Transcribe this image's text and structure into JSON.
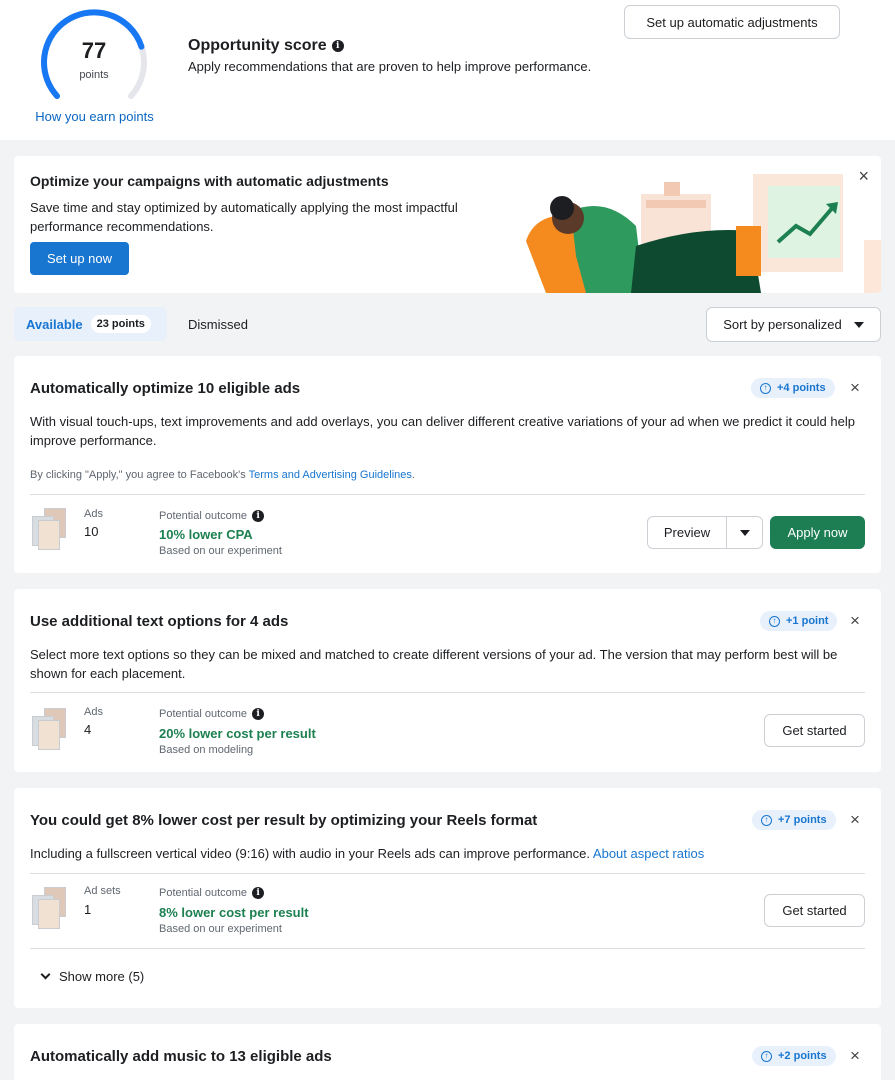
{
  "score": {
    "value": "77",
    "unit": "points",
    "fraction": 0.77,
    "how_link": "How you earn points"
  },
  "header": {
    "title": "Opportunity score",
    "subtitle": "Apply recommendations that are proven to help improve performance.",
    "auto_button": "Set up automatic adjustments"
  },
  "promo": {
    "title": "Optimize your campaigns with automatic adjustments",
    "text": "Save time and stay optimized by automatically applying the most impactful performance recommendations.",
    "button": "Set up now",
    "close": "×"
  },
  "tabs": {
    "available": "Available",
    "available_badge": "23 points",
    "dismissed": "Dismissed",
    "sort": "Sort by personalized"
  },
  "cards": [
    {
      "title": "Automatically optimize 10 eligible ads",
      "points": "+4 points",
      "desc": "With visual touch-ups, text improvements and add overlays, you can deliver different creative variations of your ad when we predict it could help improve performance.",
      "legal_prefix": "By clicking \"Apply,\" you agree to Facebook's ",
      "legal_link": "Terms and Advertising Guidelines",
      "legal_suffix": ".",
      "meta_label": "Ads",
      "meta_value": "10",
      "outcome_label": "Potential outcome",
      "outcome": "10% lower CPA",
      "based": "Based on our experiment",
      "preview": "Preview",
      "apply": "Apply now"
    },
    {
      "title": "Use additional text options for 4 ads",
      "points": "+1 point",
      "desc": "Select more text options so they can be mixed and matched to create different versions of your ad. The version that may perform best will be shown for each placement.",
      "meta_label": "Ads",
      "meta_value": "4",
      "outcome_label": "Potential outcome",
      "outcome": "20% lower cost per result",
      "based": "Based on modeling",
      "action": "Get started"
    },
    {
      "title": "You could get 8% lower cost per result by optimizing your Reels format",
      "points": "+7 points",
      "desc": "Including a fullscreen vertical video (9:16) with audio in your Reels ads can improve performance.",
      "desc_link": "About aspect ratios",
      "meta_label": "Ad sets",
      "meta_value": "1",
      "outcome_label": "Potential outcome",
      "outcome": "8% lower cost per result",
      "based": "Based on our experiment",
      "action": "Get started",
      "show_more": "Show more (5)"
    },
    {
      "title": "Automatically add music to 13 eligible ads",
      "points": "+2 points"
    }
  ],
  "colors": {
    "accent": "#1876d0",
    "success": "#1d8051",
    "apply": "#1d7e54",
    "gauge": "#1877f2"
  }
}
